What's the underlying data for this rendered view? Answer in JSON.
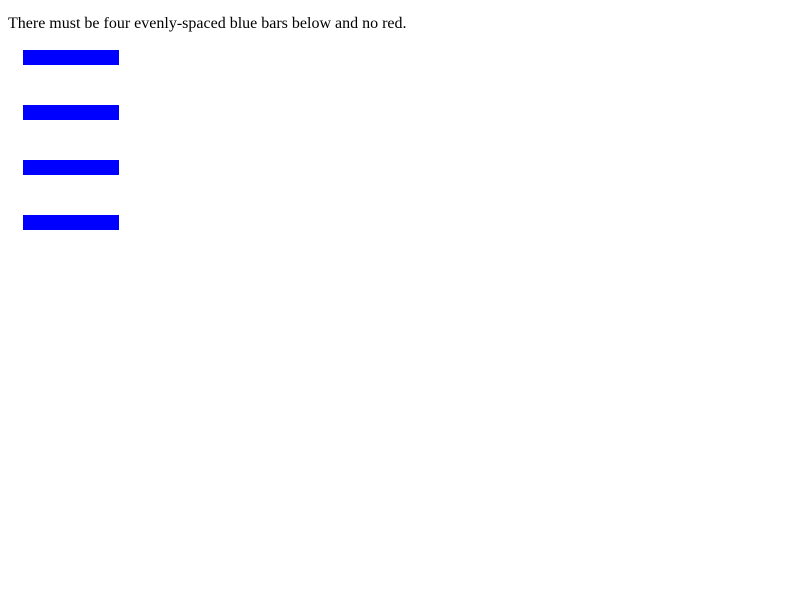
{
  "instruction_text": "There must be four evenly-spaced blue bars below and no red.",
  "colors": {
    "background": "#ffffff",
    "text": "#000000",
    "bar": "#0000ff"
  },
  "bars": [
    {
      "name": "bar-1"
    },
    {
      "name": "bar-2"
    },
    {
      "name": "bar-3"
    },
    {
      "name": "bar-4"
    }
  ]
}
